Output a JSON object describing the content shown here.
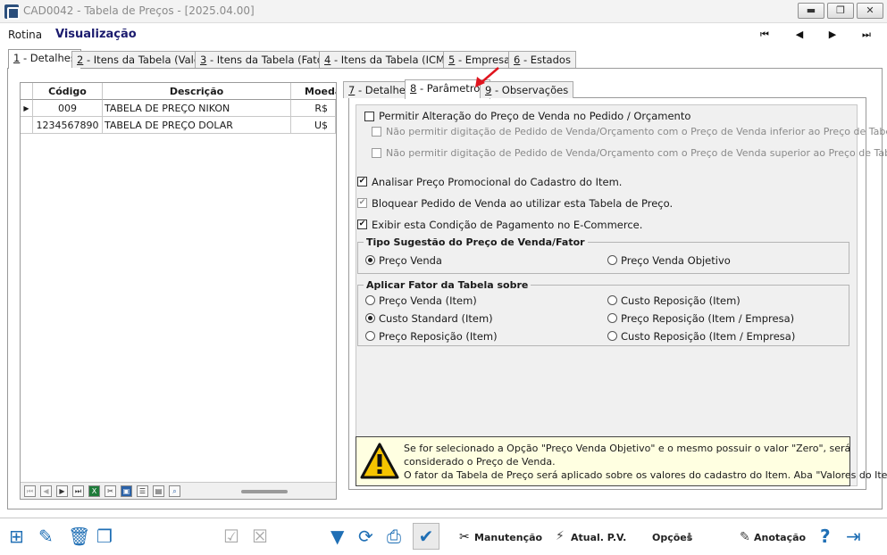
{
  "window": {
    "title": "CAD0042 - Tabela de Preços - [2025.04.00]",
    "minimize": "▬",
    "maximize": "❐",
    "close": "✕"
  },
  "menu": {
    "rotina": "Rotina",
    "mode": "Visualização"
  },
  "nav": {
    "first": "⏮",
    "prev": "◀",
    "next": "▶",
    "last": "⏭"
  },
  "tabs": [
    {
      "key": "1",
      "label": " - Detalhes"
    },
    {
      "key": "2",
      "label": " - Itens da Tabela (Valor)"
    },
    {
      "key": "3",
      "label": " - Itens da Tabela (Fator)"
    },
    {
      "key": "4",
      "label": " - Itens da Tabela (ICMS)"
    },
    {
      "key": "5",
      "label": " - Empresas"
    },
    {
      "key": "6",
      "label": " - Estados"
    }
  ],
  "grid": {
    "columns": [
      "Código",
      "Descrição",
      "Moeda"
    ],
    "rows": [
      {
        "codigo": "009",
        "descricao": "TABELA DE PREÇO NIKON",
        "moeda": "R$"
      },
      {
        "codigo": "1234567890",
        "descricao": "TABELA DE PREÇO DOLAR",
        "moeda": "U$"
      }
    ],
    "current_row_marker": "▶"
  },
  "inner_tabs": [
    {
      "key": "7",
      "label": " - Detalhes"
    },
    {
      "key": "8",
      "label": " - Parâmetros"
    },
    {
      "key": "9",
      "label": " - Observações"
    }
  ],
  "params": {
    "permitir_alteracao": {
      "label": "Permitir Alteração do Preço de Venda no Pedido / Orçamento",
      "checked": false
    },
    "nao_permitir_inferior": {
      "label": "Não permitir digitação de Pedido de Venda/Orçamento com o Preço de Venda inferior ao Preço de Tabela.",
      "checked": false
    },
    "nao_permitir_superior": {
      "label": "Não permitir digitação de Pedido de Venda/Orçamento com o Preço de Venda superior ao Preço de Tabela.",
      "checked": false
    },
    "analisar_promocional": {
      "label": "Analisar Preço Promocional do Cadastro do Item.",
      "checked": true
    },
    "bloquear_pedido": {
      "label": "Bloquear Pedido de Venda ao utilizar esta Tabela de Preço.",
      "checked": true
    },
    "exibir_ecommerce": {
      "label": "Exibir esta Condição de Pagamento no E-Commerce.",
      "checked": true
    },
    "check_mark": "✔"
  },
  "tipo_sugestao": {
    "title": "Tipo Sugestão do Preço de Venda/Fator",
    "options": [
      "Preço Venda",
      "Preço Venda Objetivo"
    ],
    "selected": "Preço Venda"
  },
  "aplicar_fator": {
    "title": "Aplicar Fator da Tabela sobre",
    "options": [
      "Preço Venda (Item)",
      "Custo Reposição (Item)",
      "Custo Standard (Item)",
      "Preço Reposição (Item / Empresa)",
      "Preço Reposição (Item)",
      "Custo Reposição (Item / Empresa)"
    ],
    "selected": "Custo Standard (Item)"
  },
  "warning": {
    "lines": [
      "Se for selecionado a Opção \"Preço Venda Objetivo\" e o mesmo possuir o valor \"Zero\", será",
      "considerado o Preço de Venda.",
      "O fator da Tabela de Preço será aplicado sobre os valores do cadastro do Item. Aba \"Valores do Item\"."
    ]
  },
  "toolbar": {
    "manutencao": "Manutenção",
    "atual_pv": "Atual. P.V.",
    "opcoes": "Opções",
    "anotacao": "Anotação",
    "help": "?"
  },
  "colors": {
    "accent": "#1f6fb5",
    "warning_bg": "#ffffe1",
    "arrow": "#e0141e"
  }
}
